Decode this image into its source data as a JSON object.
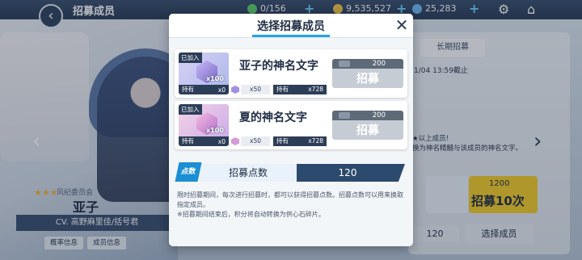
{
  "background": {
    "page_title": "招募成员",
    "stamina": "0/156",
    "credits": "9,535,527",
    "gems": "25,283",
    "tab": "长期招募",
    "deadline": "1/04 13:59截止",
    "note_line1": "★以上成员!",
    "note_line2": "换为神名精髓与该成员的神名文字。",
    "stars": "★★★",
    "school": "风纪委员会",
    "character_name": "亚子",
    "cv": "CV. 高野麻里佳/括号君",
    "prob_info": "概率信息",
    "member_info": "成员信息",
    "recruit10_cost": "1200",
    "recruit10_label": "招募10次",
    "points_value": "120",
    "select_member": "选择成员"
  },
  "modal": {
    "title": "选择招募成员",
    "close_symbol": "✕",
    "items": [
      {
        "joined_tag": "已加入",
        "gem_count": "x100",
        "hold_label": "持有",
        "hold_value": "x0",
        "name": "亚子的神名文字",
        "mini_count": "x50",
        "mini_hold_label": "持有",
        "mini_hold_value": "x728",
        "cost": "200",
        "button_label": "招募"
      },
      {
        "joined_tag": "已加入",
        "gem_count": "x100",
        "hold_label": "持有",
        "hold_value": "x0",
        "name": "夏的神名文字",
        "mini_count": "x50",
        "mini_hold_label": "持有",
        "mini_hold_value": "x728",
        "cost": "200",
        "button_label": "招募"
      }
    ],
    "points": {
      "badge": "点数",
      "label": "招募点数",
      "value": "120"
    },
    "description_line1": "限时招募期间，每次进行招募时，都可以获得招募点数。招募点数可以用来换取指定成员。",
    "description_line2": "※招募期间结束后，积分将自动转换为供心石碎片。"
  }
}
